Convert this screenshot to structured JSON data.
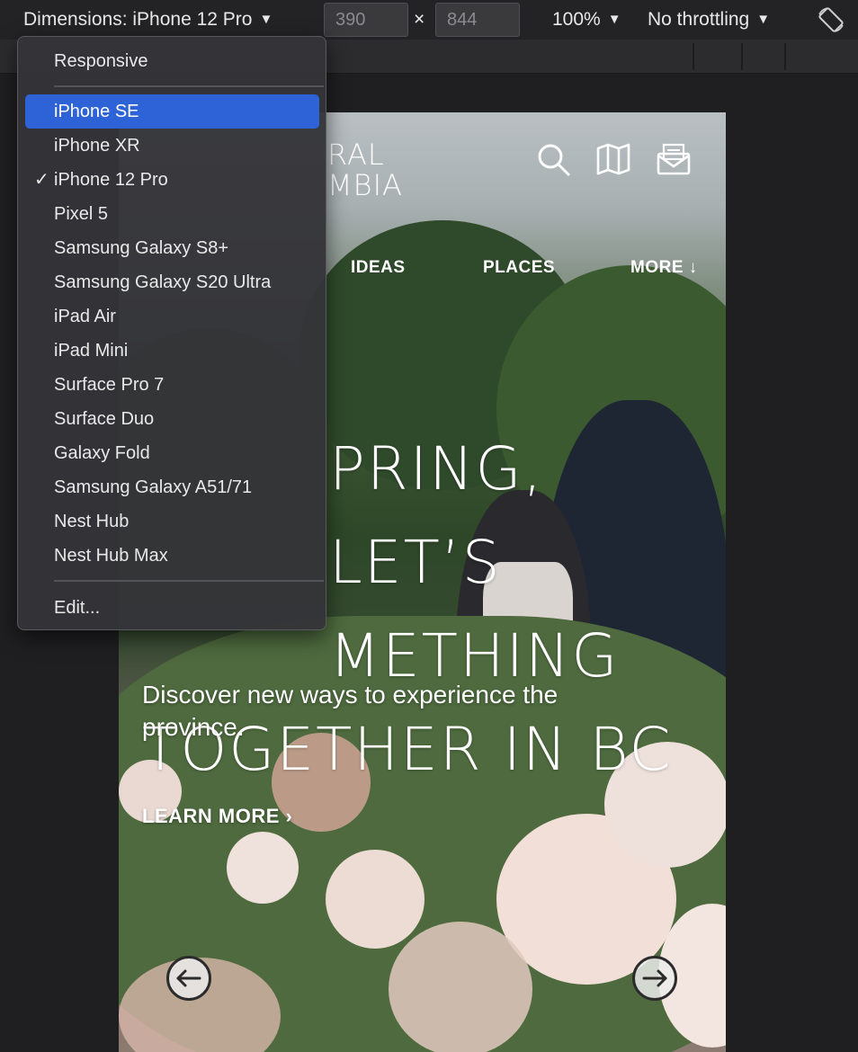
{
  "toolbar": {
    "device_label": "Dimensions: iPhone 12 Pro",
    "width": "390",
    "height": "844",
    "times": "×",
    "zoom": "100%",
    "throttling": "No throttling"
  },
  "device_menu": {
    "responsive": "Responsive",
    "devices": [
      {
        "label": "iPhone SE",
        "highlighted": true,
        "checked": false
      },
      {
        "label": "iPhone XR",
        "highlighted": false,
        "checked": false
      },
      {
        "label": "iPhone 12 Pro",
        "highlighted": false,
        "checked": true
      },
      {
        "label": "Pixel 5",
        "highlighted": false,
        "checked": false
      },
      {
        "label": "Samsung Galaxy S8+",
        "highlighted": false,
        "checked": false
      },
      {
        "label": "Samsung Galaxy S20 Ultra",
        "highlighted": false,
        "checked": false
      },
      {
        "label": "iPad Air",
        "highlighted": false,
        "checked": false
      },
      {
        "label": "iPad Mini",
        "highlighted": false,
        "checked": false
      },
      {
        "label": "Surface Pro 7",
        "highlighted": false,
        "checked": false
      },
      {
        "label": "Surface Duo",
        "highlighted": false,
        "checked": false
      },
      {
        "label": "Galaxy Fold",
        "highlighted": false,
        "checked": false
      },
      {
        "label": "Samsung Galaxy A51/71",
        "highlighted": false,
        "checked": false
      },
      {
        "label": "Nest Hub",
        "highlighted": false,
        "checked": false
      },
      {
        "label": "Nest Hub Max",
        "highlighted": false,
        "checked": false
      }
    ],
    "check_mark": "✓",
    "edit": "Edit..."
  },
  "page": {
    "logo_line1": "RAL",
    "logo_line2": "MBIA",
    "nav": {
      "ideas": "IDEAS",
      "places": "PLACES",
      "more": "MORE ↓"
    },
    "hero_title_lines": [
      "PRING, LET’S",
      "METHING",
      "TOGETHER IN BC"
    ],
    "hero_subtitle": "Discover new ways to experience the province.",
    "learn_more": "LEARN MORE ›"
  },
  "colors": {
    "menu_highlight": "#2d63d6",
    "toolbar_bg": "#232325",
    "menu_bg": "#343438"
  }
}
